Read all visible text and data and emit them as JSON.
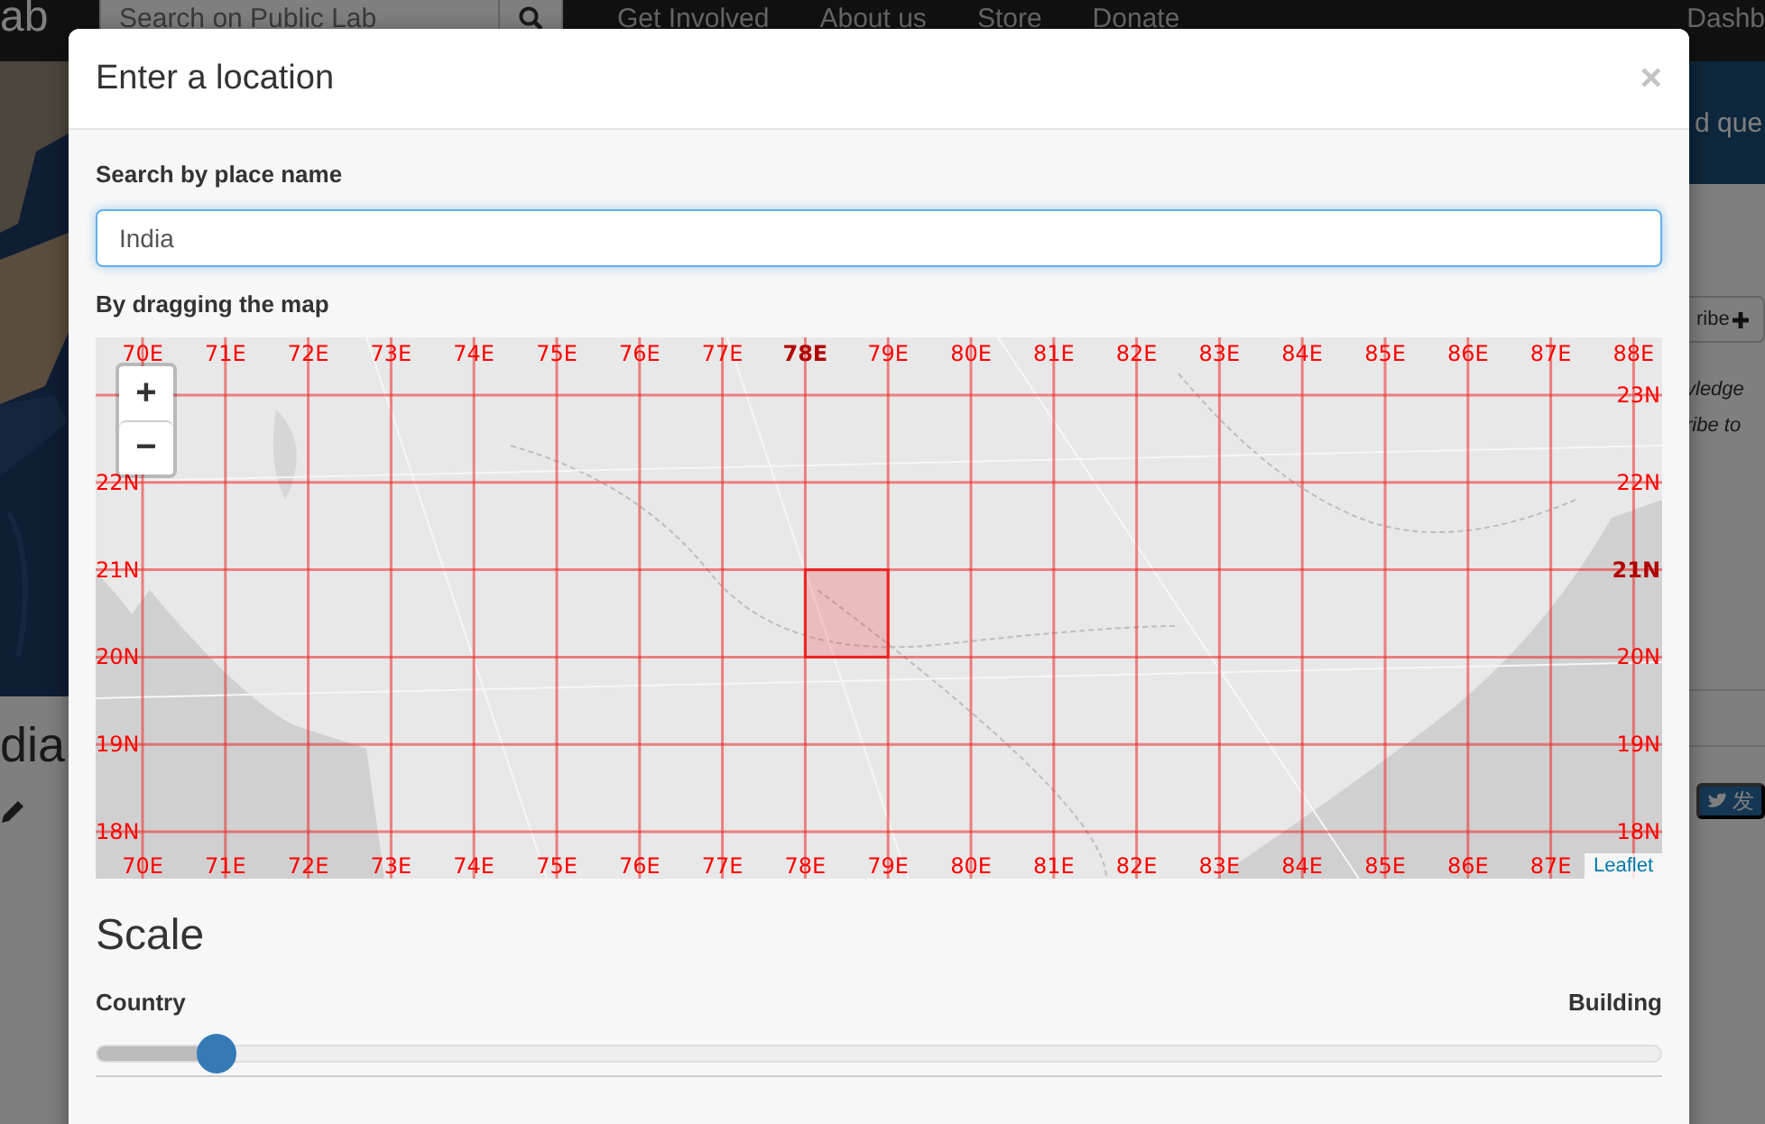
{
  "background_page": {
    "logo_fragment": "ab",
    "search": {
      "placeholder": "Search on Public Lab"
    },
    "nav_links": [
      "Get Involved",
      "About us",
      "Store",
      "Donate"
    ],
    "nav_right": "Dashb",
    "title_fragment": "dia",
    "banner_fragment": "d que",
    "subscribe_fragment": "ribe",
    "text_fragments": [
      "vledge",
      "ribe to"
    ],
    "share_fragment": "发"
  },
  "dialog": {
    "title": "Enter a location",
    "close": "×",
    "search_label": "Search by place name",
    "search_value": "India",
    "map_label": "By dragging the map",
    "map": {
      "zoom_in": "+",
      "zoom_out": "−",
      "attribution": "Leaflet",
      "longitudes": [
        {
          "top_label": "70E",
          "bottom_label": "70E",
          "selected": false
        },
        {
          "top_label": "71E",
          "bottom_label": "71E",
          "selected": false
        },
        {
          "top_label": "72E",
          "bottom_label": "72E",
          "selected": false
        },
        {
          "top_label": "73E",
          "bottom_label": "73E",
          "selected": false
        },
        {
          "top_label": "74E",
          "bottom_label": "74E",
          "selected": false
        },
        {
          "top_label": "75E",
          "bottom_label": "75E",
          "selected": false
        },
        {
          "top_label": "76E",
          "bottom_label": "76E",
          "selected": false
        },
        {
          "top_label": "77E",
          "bottom_label": "77E",
          "selected": false
        },
        {
          "top_label": "78E",
          "bottom_label": "78E",
          "selected": true
        },
        {
          "top_label": "79E",
          "bottom_label": "79E",
          "selected": false
        },
        {
          "top_label": "80E",
          "bottom_label": "80E",
          "selected": false
        },
        {
          "top_label": "81E",
          "bottom_label": "81E",
          "selected": false
        },
        {
          "top_label": "82E",
          "bottom_label": "82E",
          "selected": false
        },
        {
          "top_label": "83E",
          "bottom_label": "83E",
          "selected": false
        },
        {
          "top_label": "84E",
          "bottom_label": "84E",
          "selected": false
        },
        {
          "top_label": "85E",
          "bottom_label": "85E",
          "selected": false
        },
        {
          "top_label": "86E",
          "bottom_label": "86E",
          "selected": false
        },
        {
          "top_label": "87E",
          "bottom_label": "87E",
          "selected": false
        },
        {
          "top_label": "88E",
          "selected": false
        }
      ],
      "latitudes": [
        {
          "right_label": "23N",
          "selected": false
        },
        {
          "left_label": "22N",
          "right_label": "22N",
          "selected": false
        },
        {
          "left_label": "21N",
          "right_label": "21N",
          "selected": true
        },
        {
          "left_label": "20N",
          "right_label": "20N",
          "selected": false
        },
        {
          "left_label": "19N",
          "right_label": "19N",
          "selected": false
        },
        {
          "left_label": "18N",
          "right_label": "18N",
          "selected": false
        }
      ]
    },
    "scale": {
      "title": "Scale",
      "min_label": "Country",
      "max_label": "Building",
      "level": 0.077
    }
  }
}
